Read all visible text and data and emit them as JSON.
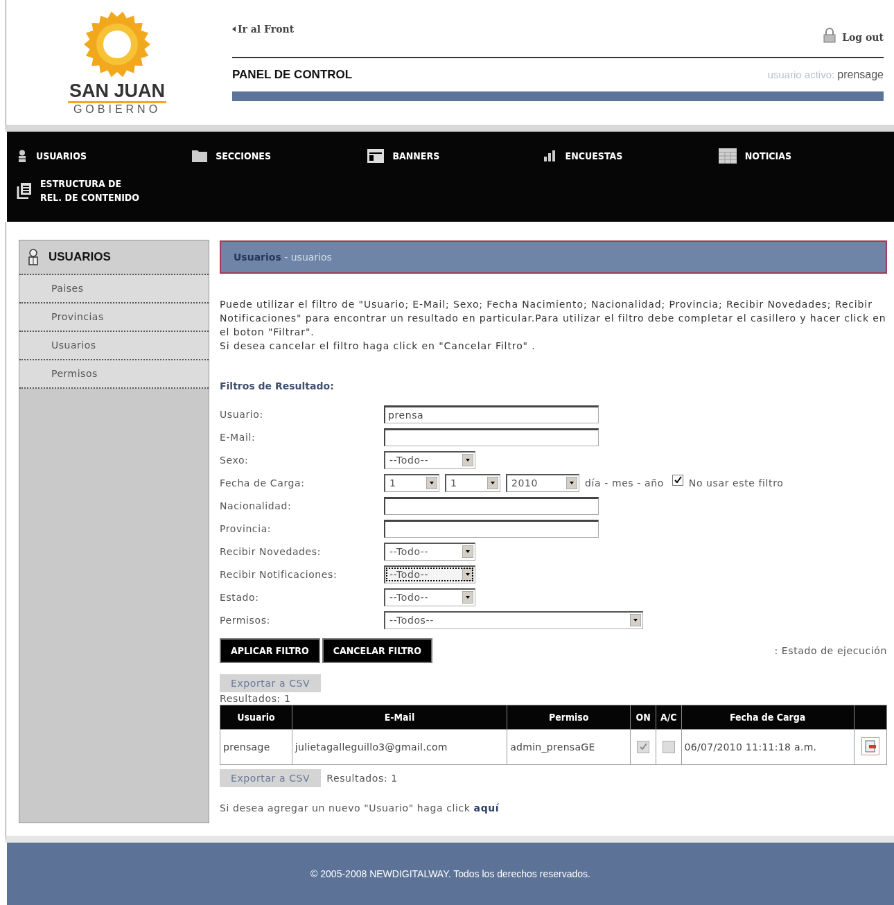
{
  "header": {
    "logo_title": "SAN JUAN",
    "logo_subtitle": "GOBIERNO",
    "front_link": "Ir al Front",
    "logout": "Log out",
    "panel_title": "PANEL DE CONTROL",
    "active_user_label": "usuario activo:",
    "active_user": "prensage"
  },
  "nav": [
    {
      "label": "USUARIOS",
      "kind": "user"
    },
    {
      "label": "SECCIONES",
      "kind": "folder"
    },
    {
      "label": "BANNERS",
      "kind": "window"
    },
    {
      "label": "ENCUESTAS",
      "kind": "bars"
    },
    {
      "label": "NOTICIAS",
      "kind": "grid"
    },
    {
      "label": "ESTRUCTURA DE\nREL. DE CONTENIDO",
      "kind": "document"
    }
  ],
  "sidebar": {
    "title": "USUARIOS",
    "items": [
      {
        "label": "Paises"
      },
      {
        "label": "Provincias"
      },
      {
        "label": "Usuarios"
      },
      {
        "label": "Permisos"
      }
    ]
  },
  "page_heading": {
    "section": "Usuarios",
    "separator": "-",
    "page": "usuarios"
  },
  "intro": [
    "Puede utilizar el filtro de \"Usuario; E-Mail; Sexo; Fecha Nacimiento; Nacionalidad; Provincia; Recibir Novedades; Recibir Notificaciones\" para encontrar un resultado en particular.Para utilizar el filtro debe completar el casillero y hacer click en el boton \"Filtrar\".",
    "Si desea cancelar el filtro haga click en \"Cancelar Filtro\" ."
  ],
  "filters": {
    "title": "Filtros de Resultado:",
    "fields": [
      {
        "kind": "text",
        "label": "Usuario:",
        "value": "prensa"
      },
      {
        "kind": "text",
        "label": "E-Mail:"
      },
      {
        "kind": "select",
        "label": "Sexo:",
        "value": "--Todo--",
        "focused": false
      },
      {
        "kind": "date",
        "label": "Fecha de Carga:",
        "day": "1",
        "month": "1",
        "year": "2010",
        "hint": "día - mes - año",
        "checkbox_label": "No usar este filtro",
        "checked": true
      },
      {
        "kind": "text",
        "label": "Nacionalidad:"
      },
      {
        "kind": "text",
        "label": "Provincia:"
      },
      {
        "kind": "select",
        "label": "Recibir Novedades:",
        "value": "--Todo--",
        "focused": false
      },
      {
        "kind": "select",
        "label": "Recibir Notificaciones:",
        "value": "--Todo--",
        "focused": true
      },
      {
        "kind": "select",
        "label": "Estado:",
        "value": "--Todo--",
        "focused": false
      },
      {
        "kind": "select_wide",
        "label": "Permisos:",
        "value": "--Todos--",
        "focused": false
      }
    ]
  },
  "buttons": [
    "APLICAR FILTRO",
    "CANCELAR FILTRO"
  ],
  "execution_status": ": Estado de ejecución",
  "export_top": "Exportar a CSV",
  "results_top": "Resultados: 1",
  "table": {
    "columns": [
      "Usuario",
      "E-Mail",
      "Permiso",
      "ON",
      "A/C",
      "Fecha de Carga"
    ],
    "rows": [
      {
        "usuario": "prensage",
        "email": "julietagalleguillo3@gmail.com",
        "permiso": "admin_prensaGE",
        "on": true,
        "ac": false,
        "fecha": "06/07/2010 11:11:18 a.m."
      }
    ]
  },
  "export_bottom": "Exportar a CSV",
  "results_bottom": "Resultados: 1",
  "add_text": "Si desea agregar un nuevo \"Usuario\" haga click",
  "add_link": "aquí",
  "footer": "© 2005-2008 NEWDIGITALWAY. Todos los derechos reservados."
}
